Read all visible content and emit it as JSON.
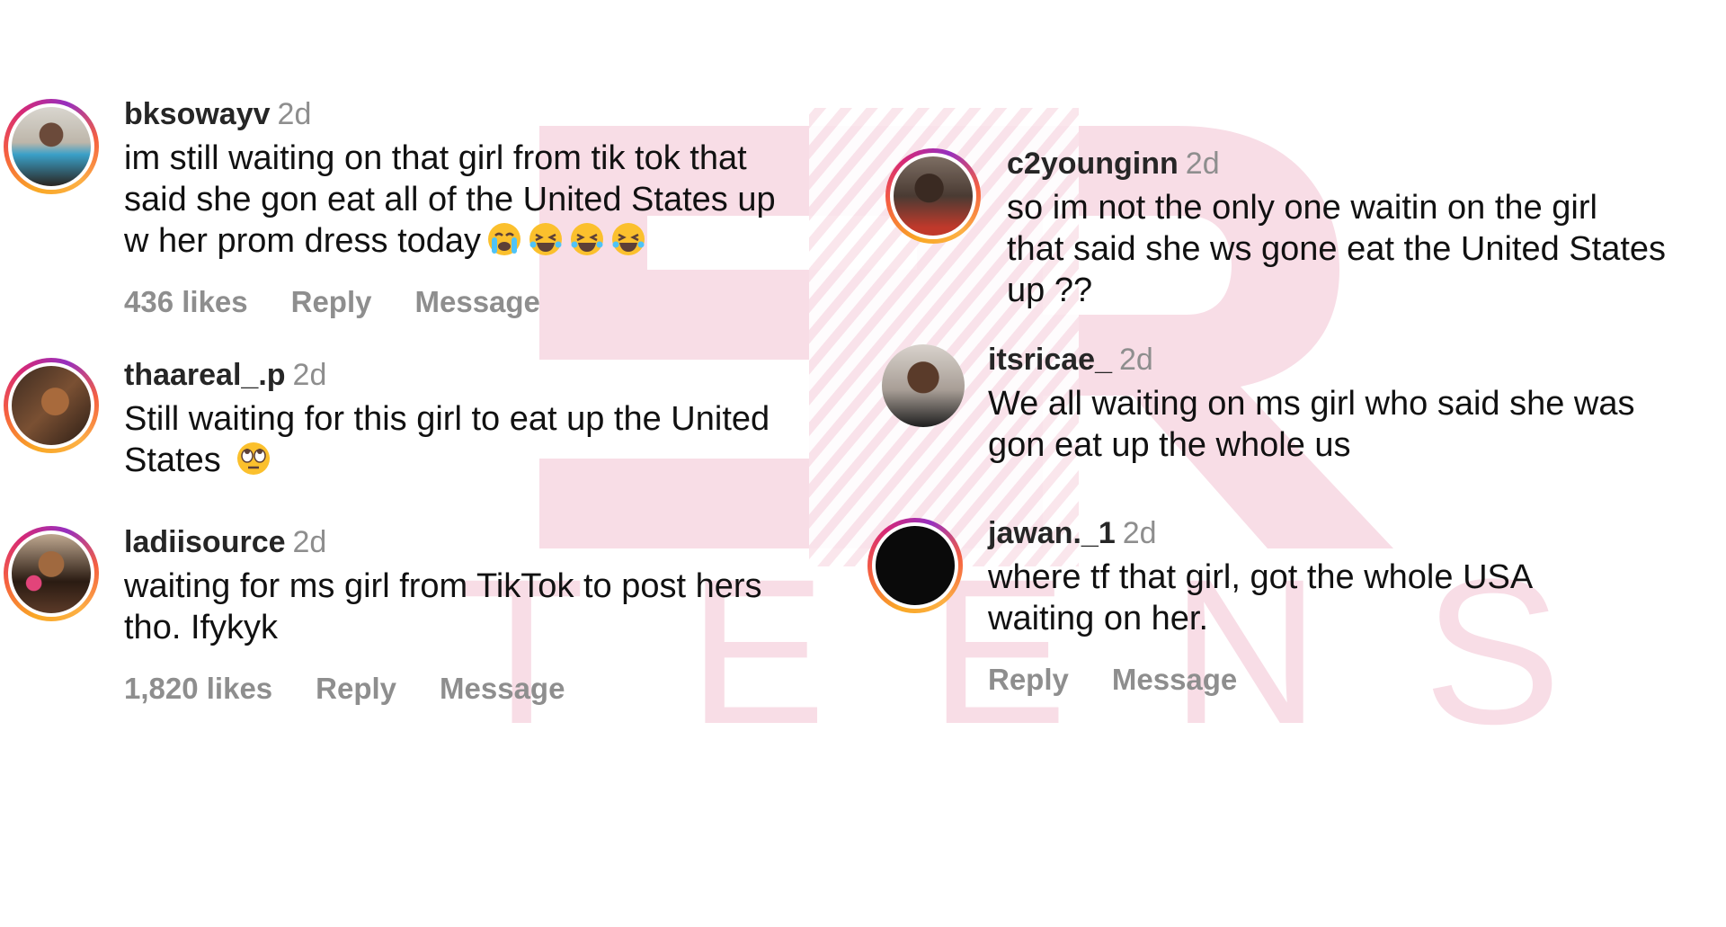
{
  "colors": {
    "username": "#262626",
    "meta": "#8e8e8e",
    "text": "#111111",
    "watermark": "#f8dde6"
  },
  "watermark": {
    "word": "TEENS"
  },
  "actions": {
    "reply": "Reply",
    "message": "Message"
  },
  "comments": [
    {
      "user": "bksowayv",
      "time": "2d",
      "text": "im still waiting on that girl from tik tok that\nsaid she gon eat all of the United States up\nw her prom dress today",
      "emojis": [
        "crying-emoji",
        "laughing-emoji",
        "laughing-emoji",
        "laughing-emoji"
      ],
      "likes": "436 likes"
    },
    {
      "user": "thaareal_.p",
      "time": "2d",
      "text": "Still waiting for this girl to eat up the United\nStates",
      "emojis": [
        "eye-roll-emoji"
      ]
    },
    {
      "user": "ladiisource",
      "time": "2d",
      "text": "waiting for ms girl from TikTok to post hers\ntho. Ifykyk",
      "likes": "1,820 likes"
    },
    {
      "user": "c2younginn",
      "time": "2d",
      "text": "so im not the only one waitin on the girl\nthat said she ws gone eat the United States\nup ??"
    },
    {
      "user": "itsricae_",
      "time": "2d",
      "text": "We all waiting on ms girl who said she was\ngon eat up the whole us"
    },
    {
      "user": "jawan._1",
      "time": "2d",
      "text": "where tf that girl, got the whole USA\nwaiting on her."
    }
  ]
}
